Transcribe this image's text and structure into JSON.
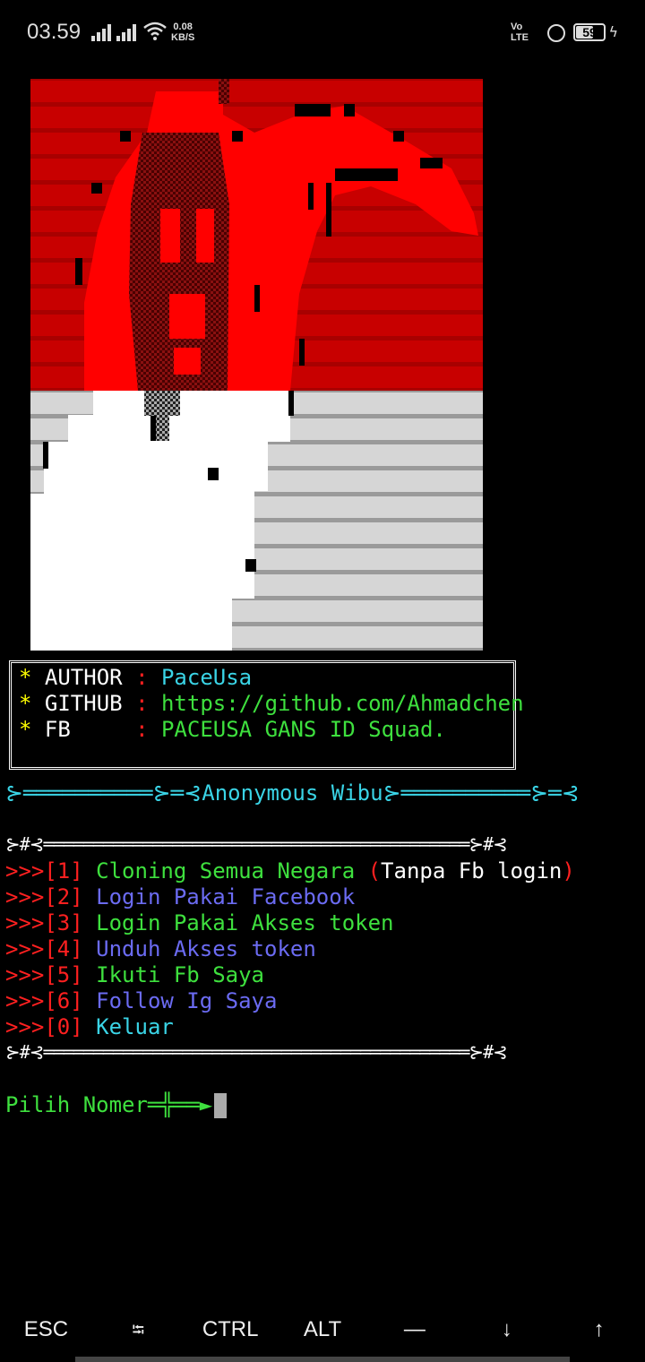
{
  "status_bar": {
    "time": "03.59",
    "net_speed_value": "0.08",
    "net_speed_unit": "KB/S",
    "volte_top": "Vo",
    "volte_bottom": "LTE",
    "battery": "59",
    "icons": [
      "signal-icon",
      "signal-icon",
      "wifi-icon",
      "volte-icon",
      "lock-icon",
      "battery-icon",
      "charging-icon"
    ]
  },
  "banner_art": {
    "description_colors": {
      "red": "#ff0000",
      "dark_red": "#b80000",
      "white": "#ffffff",
      "gray": "#cfcfcf"
    }
  },
  "info": {
    "author_label": "AUTHOR",
    "author_value": "PaceUsa",
    "github_label": "GITHUB",
    "github_value": "https://github.com/Ahmadchen",
    "fb_label": "FB",
    "fb_value": "PACEUSA GANS ID Squad.",
    "separator": ":",
    "bullet": "*"
  },
  "title_line": {
    "left": "⊱══════════⊱═⊰",
    "text": "Anonymous Wibu",
    "right": "⊱══════════⊱═⊰"
  },
  "menu": {
    "top_rule": "⊱#⊰═══════════════════════════════════════════⊱#⊰",
    "bottom_rule": "⊱#⊰═══════════════════════════════════════════⊱#⊰",
    "items": [
      {
        "prefix": ">>>[1]",
        "label": "Cloning Semua Negara",
        "extra_open": "(",
        "extra": "Tanpa Fb login",
        "extra_close": ")"
      },
      {
        "prefix": ">>>[2]",
        "label": "Login Pakai Facebook"
      },
      {
        "prefix": ">>>[3]",
        "label": "Login Pakai Akses token"
      },
      {
        "prefix": ">>>[4]",
        "label": "Unduh Akses token"
      },
      {
        "prefix": ">>>[5]",
        "label": "Ikuti Fb Saya"
      },
      {
        "prefix": ">>>[6]",
        "label": "Follow Ig Saya"
      },
      {
        "prefix": ">>>[0]",
        "label": "Keluar"
      }
    ]
  },
  "prompt": {
    "label": "Pilih Nomer",
    "arrow": "═╬══►"
  },
  "extra_keys": [
    "ESC",
    "⭾",
    "CTRL",
    "ALT",
    "—",
    "↓",
    "↑"
  ],
  "colors": {
    "prompt": "#3ee03e",
    "accent": "#3ad4e6",
    "menu_prefix": "#ff2020"
  }
}
